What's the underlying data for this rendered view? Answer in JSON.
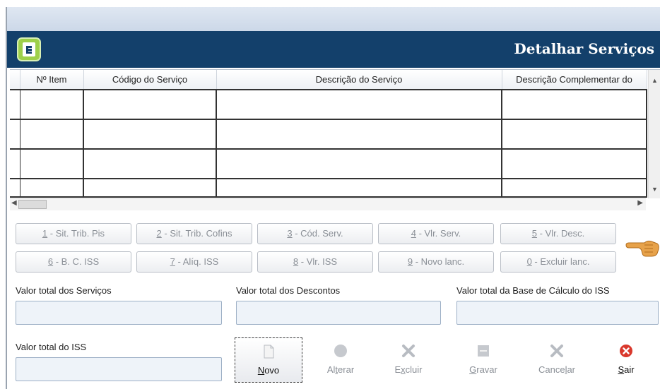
{
  "header": {
    "title": "Detalhar Serviços"
  },
  "grid": {
    "columns": [
      "Nº Item",
      "Código do Serviço",
      "Descrição do Serviço",
      "Descrição Complementar do"
    ],
    "rows": [
      [
        "",
        "",
        "",
        ""
      ],
      [
        "",
        "",
        "",
        ""
      ],
      [
        "",
        "",
        "",
        ""
      ],
      [
        "",
        "",
        "",
        ""
      ]
    ]
  },
  "shortcut_buttons": [
    {
      "key": "1",
      "label": " - Sit. Trib. Pis"
    },
    {
      "key": "2",
      "label": " - Sit. Trib. Cofins"
    },
    {
      "key": "3",
      "label": " - Cód. Serv."
    },
    {
      "key": "4",
      "label": " - Vlr. Serv."
    },
    {
      "key": "5",
      "label": " - Vlr. Desc."
    },
    {
      "key": "6",
      "label": " - B. C. ISS"
    },
    {
      "key": "7",
      "label": " - Alíq. ISS"
    },
    {
      "key": "8",
      "label": " - Vlr. ISS"
    },
    {
      "key": "9",
      "label": " - Novo lanc."
    },
    {
      "key": "0",
      "label": " - Excluir lanc."
    }
  ],
  "totals": {
    "servicos_label": "Valor total dos Serviços",
    "servicos_value": "",
    "descontos_label": "Valor total dos Descontos",
    "descontos_value": "",
    "base_iss_label": "Valor total da Base de Cálculo do ISS",
    "base_iss_value": "",
    "iss_label": "Valor total do ISS",
    "iss_value": ""
  },
  "toolbar": {
    "novo": {
      "pre": "",
      "ul": "N",
      "post": "ovo"
    },
    "alterar": {
      "pre": "Al",
      "ul": "t",
      "post": "erar"
    },
    "excluir": {
      "pre": "E",
      "ul": "x",
      "post": "cluir"
    },
    "gravar": {
      "pre": "",
      "ul": "G",
      "post": "ravar"
    },
    "cancelar": {
      "pre": "Cance",
      "ul": "l",
      "post": "ar"
    },
    "sair": {
      "pre": "",
      "ul": "S",
      "post": "air"
    }
  },
  "colors": {
    "header_bg": "#13406b",
    "logo_green": "#9ed04a",
    "sair_red": "#d9382c"
  },
  "icons": [
    "app-logo-icon",
    "pointing-hand-icon",
    "document-icon",
    "circle-icon",
    "x-icon",
    "save-icon",
    "x-icon",
    "close-circle-icon"
  ]
}
